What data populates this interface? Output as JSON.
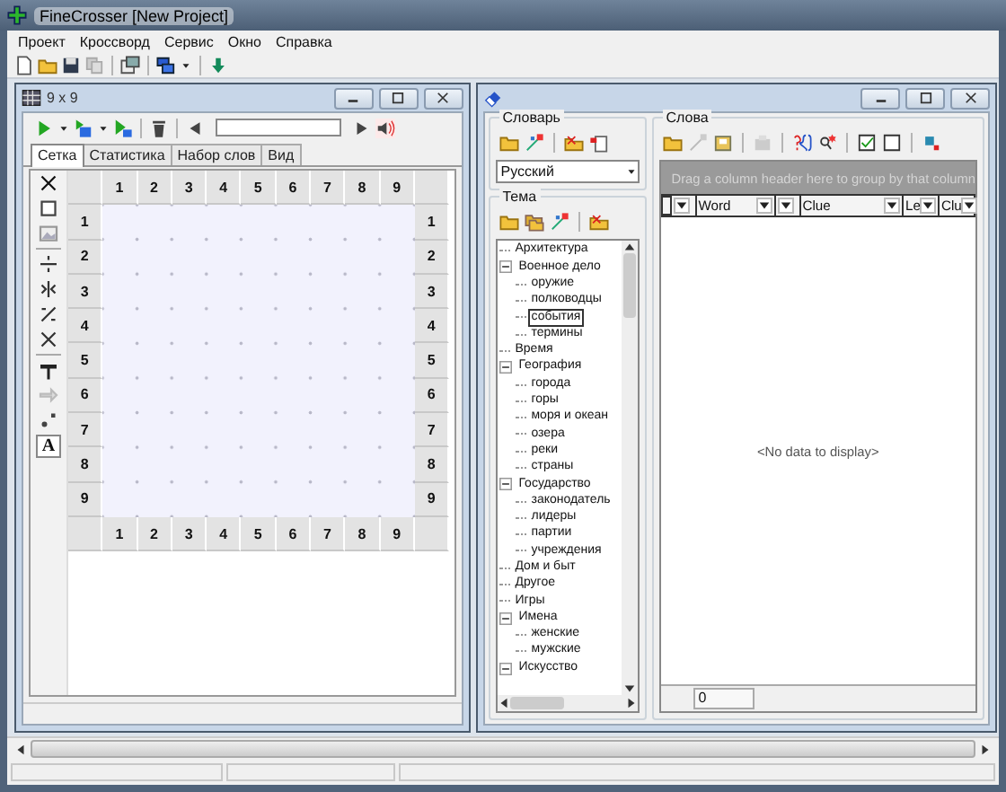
{
  "window": {
    "title": "FineCrosser [New Project]"
  },
  "menu": [
    {
      "label": "Проект"
    },
    {
      "label": "Кроссворд"
    },
    {
      "label": "Сервис"
    },
    {
      "label": "Окно"
    },
    {
      "label": "Справка"
    }
  ],
  "left_window": {
    "title": "9 x 9",
    "tabs": [
      {
        "label": "Сетка",
        "selected": true
      },
      {
        "label": "Статистика",
        "selected": false
      },
      {
        "label": "Набор слов",
        "selected": false
      },
      {
        "label": "Вид",
        "selected": false
      }
    ],
    "grid": {
      "top_labels": [
        "1",
        "2",
        "3",
        "4",
        "5",
        "6",
        "7",
        "8",
        "9"
      ],
      "left_labels": [
        "1",
        "2",
        "3",
        "4",
        "5",
        "6",
        "7",
        "8",
        "9"
      ],
      "right_labels": [
        "1",
        "2",
        "3",
        "4",
        "5",
        "6",
        "7",
        "8",
        "9"
      ],
      "bottom_labels": [
        "1",
        "2",
        "3",
        "4",
        "5",
        "6",
        "7",
        "8",
        "9"
      ]
    },
    "font_tool_letter": "A"
  },
  "right_window": {
    "dictionary": {
      "title": "Словарь",
      "language": "Русский"
    },
    "topics": {
      "title": "Тема",
      "tree": [
        {
          "label": "Архитектура",
          "selected": false
        },
        {
          "label": "Военное дело",
          "selected": false,
          "expanded": true,
          "children": [
            {
              "label": "оружие",
              "selected": false
            },
            {
              "label": "полководцы",
              "selected": false
            },
            {
              "label": "события",
              "selected": true
            },
            {
              "label": "термины",
              "selected": false
            }
          ]
        },
        {
          "label": "Время",
          "selected": false
        },
        {
          "label": "География",
          "selected": false,
          "expanded": true,
          "children": [
            {
              "label": "города",
              "selected": false
            },
            {
              "label": "горы",
              "selected": false
            },
            {
              "label": "моря и океан",
              "selected": false
            },
            {
              "label": "озера",
              "selected": false
            },
            {
              "label": "реки",
              "selected": false
            },
            {
              "label": "страны",
              "selected": false
            }
          ]
        },
        {
          "label": "Государство",
          "selected": false,
          "expanded": true,
          "children": [
            {
              "label": "законодатель",
              "selected": false
            },
            {
              "label": "лидеры",
              "selected": false
            },
            {
              "label": "партии",
              "selected": false
            },
            {
              "label": "учреждения",
              "selected": false
            }
          ]
        },
        {
          "label": "Дом и быт",
          "selected": false
        },
        {
          "label": "Другое",
          "selected": false
        },
        {
          "label": "Игры",
          "selected": false
        },
        {
          "label": "Имена",
          "selected": false,
          "expanded": true,
          "children": [
            {
              "label": "женские",
              "selected": false
            },
            {
              "label": "мужские",
              "selected": false
            }
          ]
        },
        {
          "label": "Искусство",
          "selected": false,
          "expanded": true
        }
      ]
    },
    "words": {
      "title": "Слова",
      "group_hint": "Drag a column header here to group by that column",
      "columns": [
        {
          "kind": "indicator"
        },
        {
          "kind": "filter"
        },
        {
          "kind": "field",
          "label": "Word"
        },
        {
          "kind": "filter"
        },
        {
          "kind": "field",
          "label": "Clue"
        },
        {
          "kind": "field",
          "label": "Le"
        },
        {
          "kind": "field",
          "label": "Clu"
        }
      ],
      "empty_text": "<No data to display>",
      "count": "0"
    }
  }
}
